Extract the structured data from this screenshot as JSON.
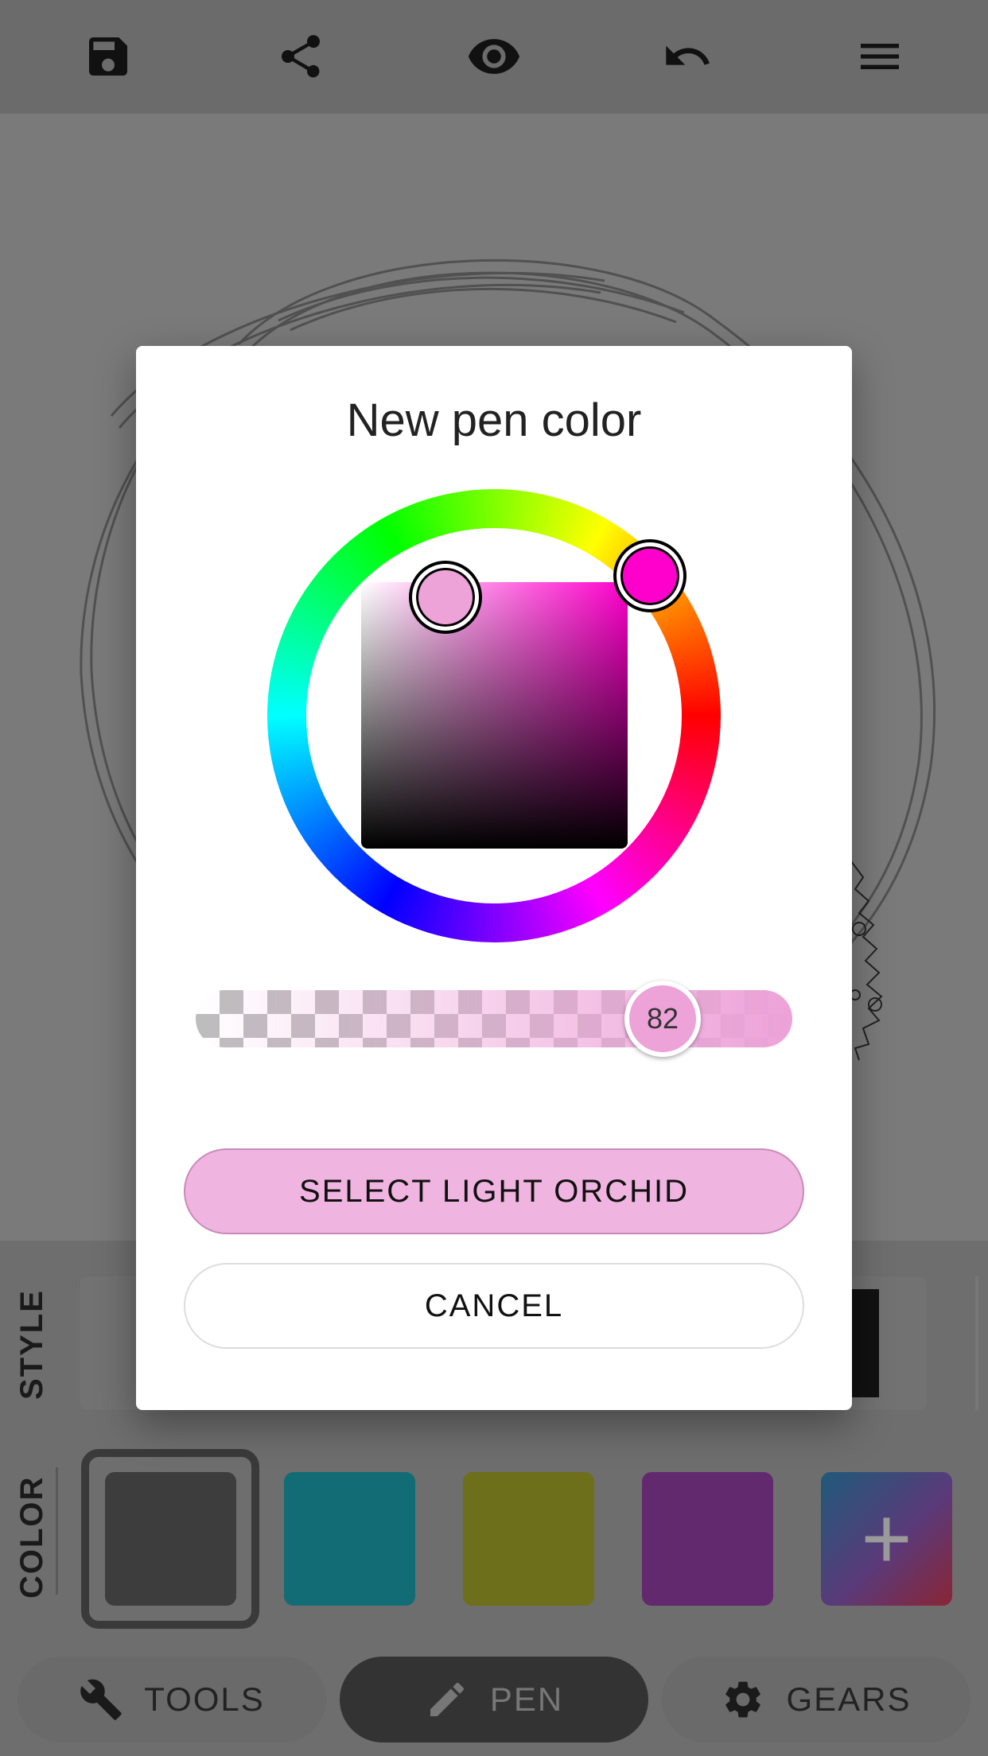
{
  "toolbar": {
    "icons": [
      "save-icon",
      "share-icon",
      "eye-icon",
      "undo-icon",
      "menu-icon"
    ]
  },
  "bottom_panel": {
    "style_label": "STYLE",
    "color_label": "COLOR",
    "swatches": [
      {
        "name": "dark-gray",
        "color": "#3d3d3d",
        "selected": true
      },
      {
        "name": "teal",
        "color": "#126c75"
      },
      {
        "name": "olive",
        "color": "#6e6f1a"
      },
      {
        "name": "purple",
        "color": "#63296e"
      }
    ],
    "add_color_symbol": "+"
  },
  "nav": {
    "tools_label": "TOOLS",
    "pen_label": "PEN",
    "gears_label": "GEARS"
  },
  "dialog": {
    "title": "New pen color",
    "hue_color": "#ff00cc",
    "selected_color": "#eda2d8",
    "opacity_value": "82",
    "select_label": "SELECT LIGHT ORCHID",
    "cancel_label": "CANCEL"
  }
}
